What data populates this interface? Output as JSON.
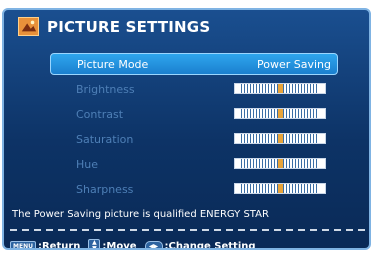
{
  "header": {
    "title": "PICTURE SETTINGS",
    "icon": "picture-settings-icon"
  },
  "menu": {
    "items": [
      {
        "label": "Picture Mode",
        "value": "Power Saving",
        "selected": true
      },
      {
        "label": "Brightness",
        "slider_level": 0.5
      },
      {
        "label": "Contrast",
        "slider_level": 0.5
      },
      {
        "label": "Saturation",
        "slider_level": 0.5
      },
      {
        "label": "Hue",
        "slider_level": 0.5
      },
      {
        "label": "Sharpness",
        "slider_level": 0.5
      }
    ]
  },
  "note": "The Power Saving picture is qualified ENERGY STAR",
  "footer": {
    "menu_key": "MENU",
    "return_label": ":Return",
    "move_label": ":Move",
    "change_label": ":Change Setting"
  },
  "colors": {
    "panel": "#0d3366",
    "selected_row": "#1b7fcf",
    "dim_text": "#4e7fb6"
  }
}
